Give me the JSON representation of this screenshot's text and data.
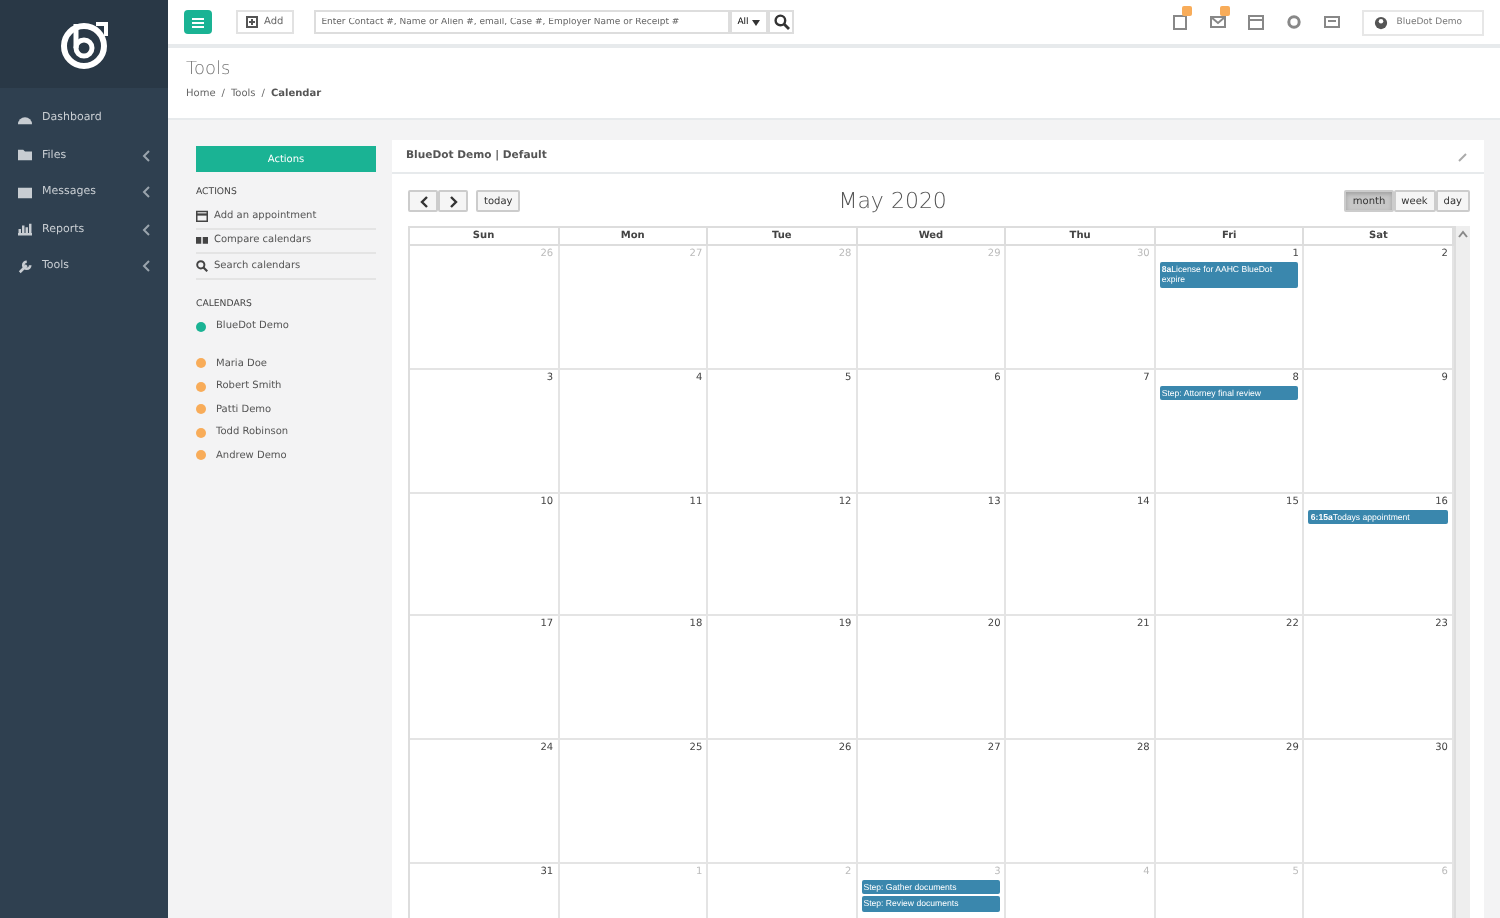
{
  "sidebar": {
    "items": [
      {
        "label": "Dashboard",
        "has_submenu": false
      },
      {
        "label": "Files",
        "has_submenu": true
      },
      {
        "label": "Messages",
        "has_submenu": true
      },
      {
        "label": "Reports",
        "has_submenu": true
      },
      {
        "label": "Tools",
        "has_submenu": true
      }
    ]
  },
  "topbar": {
    "add_label": "Add",
    "search": {
      "placeholder": "Enter Contact #, Name or Alien #, email, Case #, Employer Name or Receipt #",
      "scope": "All"
    },
    "user": "BlueDot Demo"
  },
  "header": {
    "title": "Tools",
    "separator": "/",
    "breadcrumb": [
      {
        "label": "Home",
        "current": false
      },
      {
        "label": "Tools",
        "current": false
      },
      {
        "label": "Calendar",
        "current": true
      }
    ]
  },
  "left_panel": {
    "button": "Actions",
    "actions_heading": "ACTIONS",
    "actions": [
      {
        "label": "Add an appointment"
      },
      {
        "label": "Compare calendars"
      },
      {
        "label": "Search calendars"
      }
    ],
    "calendars_heading": "CALENDARS",
    "calendars": [
      {
        "name": "BlueDot Demo",
        "color": "#1ab394"
      },
      {
        "name": "Maria Doe",
        "color": "#f8ac59"
      },
      {
        "name": "Robert Smith",
        "color": "#f8ac59"
      },
      {
        "name": "Patti Demo",
        "color": "#f8ac59"
      },
      {
        "name": "Todd Robinson",
        "color": "#f8ac59"
      },
      {
        "name": "Andrew Demo",
        "color": "#f8ac59"
      }
    ]
  },
  "calendar": {
    "title": "BlueDot Demo | Default",
    "today_label": "today",
    "month_title": "May 2020",
    "views": [
      {
        "label": "month",
        "selected": true
      },
      {
        "label": "week",
        "selected": false
      },
      {
        "label": "day",
        "selected": false
      }
    ],
    "weekdays": [
      "Sun",
      "Mon",
      "Tue",
      "Wed",
      "Thu",
      "Fri",
      "Sat"
    ],
    "weeks": [
      [
        {
          "day": "26",
          "other_month": true
        },
        {
          "day": "27",
          "other_month": true
        },
        {
          "day": "28",
          "other_month": true
        },
        {
          "day": "29",
          "other_month": true
        },
        {
          "day": "30",
          "other_month": true
        },
        {
          "day": "1",
          "other_month": false,
          "events": [
            {
              "time": "8a",
              "title": "License for AAHC BlueDot expire"
            }
          ]
        },
        {
          "day": "2",
          "other_month": false
        }
      ],
      [
        {
          "day": "3",
          "other_month": false
        },
        {
          "day": "4",
          "other_month": false
        },
        {
          "day": "5",
          "other_month": false
        },
        {
          "day": "6",
          "other_month": false
        },
        {
          "day": "7",
          "other_month": false
        },
        {
          "day": "8",
          "other_month": false,
          "events": [
            {
              "title": "Step: Attorney final review"
            }
          ]
        },
        {
          "day": "9",
          "other_month": false
        }
      ],
      [
        {
          "day": "10",
          "other_month": false
        },
        {
          "day": "11",
          "other_month": false
        },
        {
          "day": "12",
          "other_month": false
        },
        {
          "day": "13",
          "other_month": false
        },
        {
          "day": "14",
          "other_month": false
        },
        {
          "day": "15",
          "other_month": false
        },
        {
          "day": "16",
          "other_month": false,
          "events": [
            {
              "time": "6:15a",
              "title": "Todays appointment"
            }
          ]
        }
      ],
      [
        {
          "day": "17",
          "other_month": false
        },
        {
          "day": "18",
          "other_month": false
        },
        {
          "day": "19",
          "other_month": false
        },
        {
          "day": "20",
          "other_month": false
        },
        {
          "day": "21",
          "other_month": false
        },
        {
          "day": "22",
          "other_month": false
        },
        {
          "day": "23",
          "other_month": false
        }
      ],
      [
        {
          "day": "24",
          "other_month": false
        },
        {
          "day": "25",
          "other_month": false
        },
        {
          "day": "26",
          "other_month": false
        },
        {
          "day": "27",
          "other_month": false
        },
        {
          "day": "28",
          "other_month": false
        },
        {
          "day": "29",
          "other_month": false
        },
        {
          "day": "30",
          "other_month": false
        }
      ],
      [
        {
          "day": "31",
          "other_month": false
        },
        {
          "day": "1",
          "other_month": true
        },
        {
          "day": "2",
          "other_month": true
        },
        {
          "day": "3",
          "other_month": true,
          "events": [
            {
              "title": "Step: Gather documents"
            },
            {
              "title": "Step: Review documents"
            }
          ]
        },
        {
          "day": "4",
          "other_month": true
        },
        {
          "day": "5",
          "other_month": true
        },
        {
          "day": "6",
          "other_month": true
        }
      ]
    ]
  }
}
